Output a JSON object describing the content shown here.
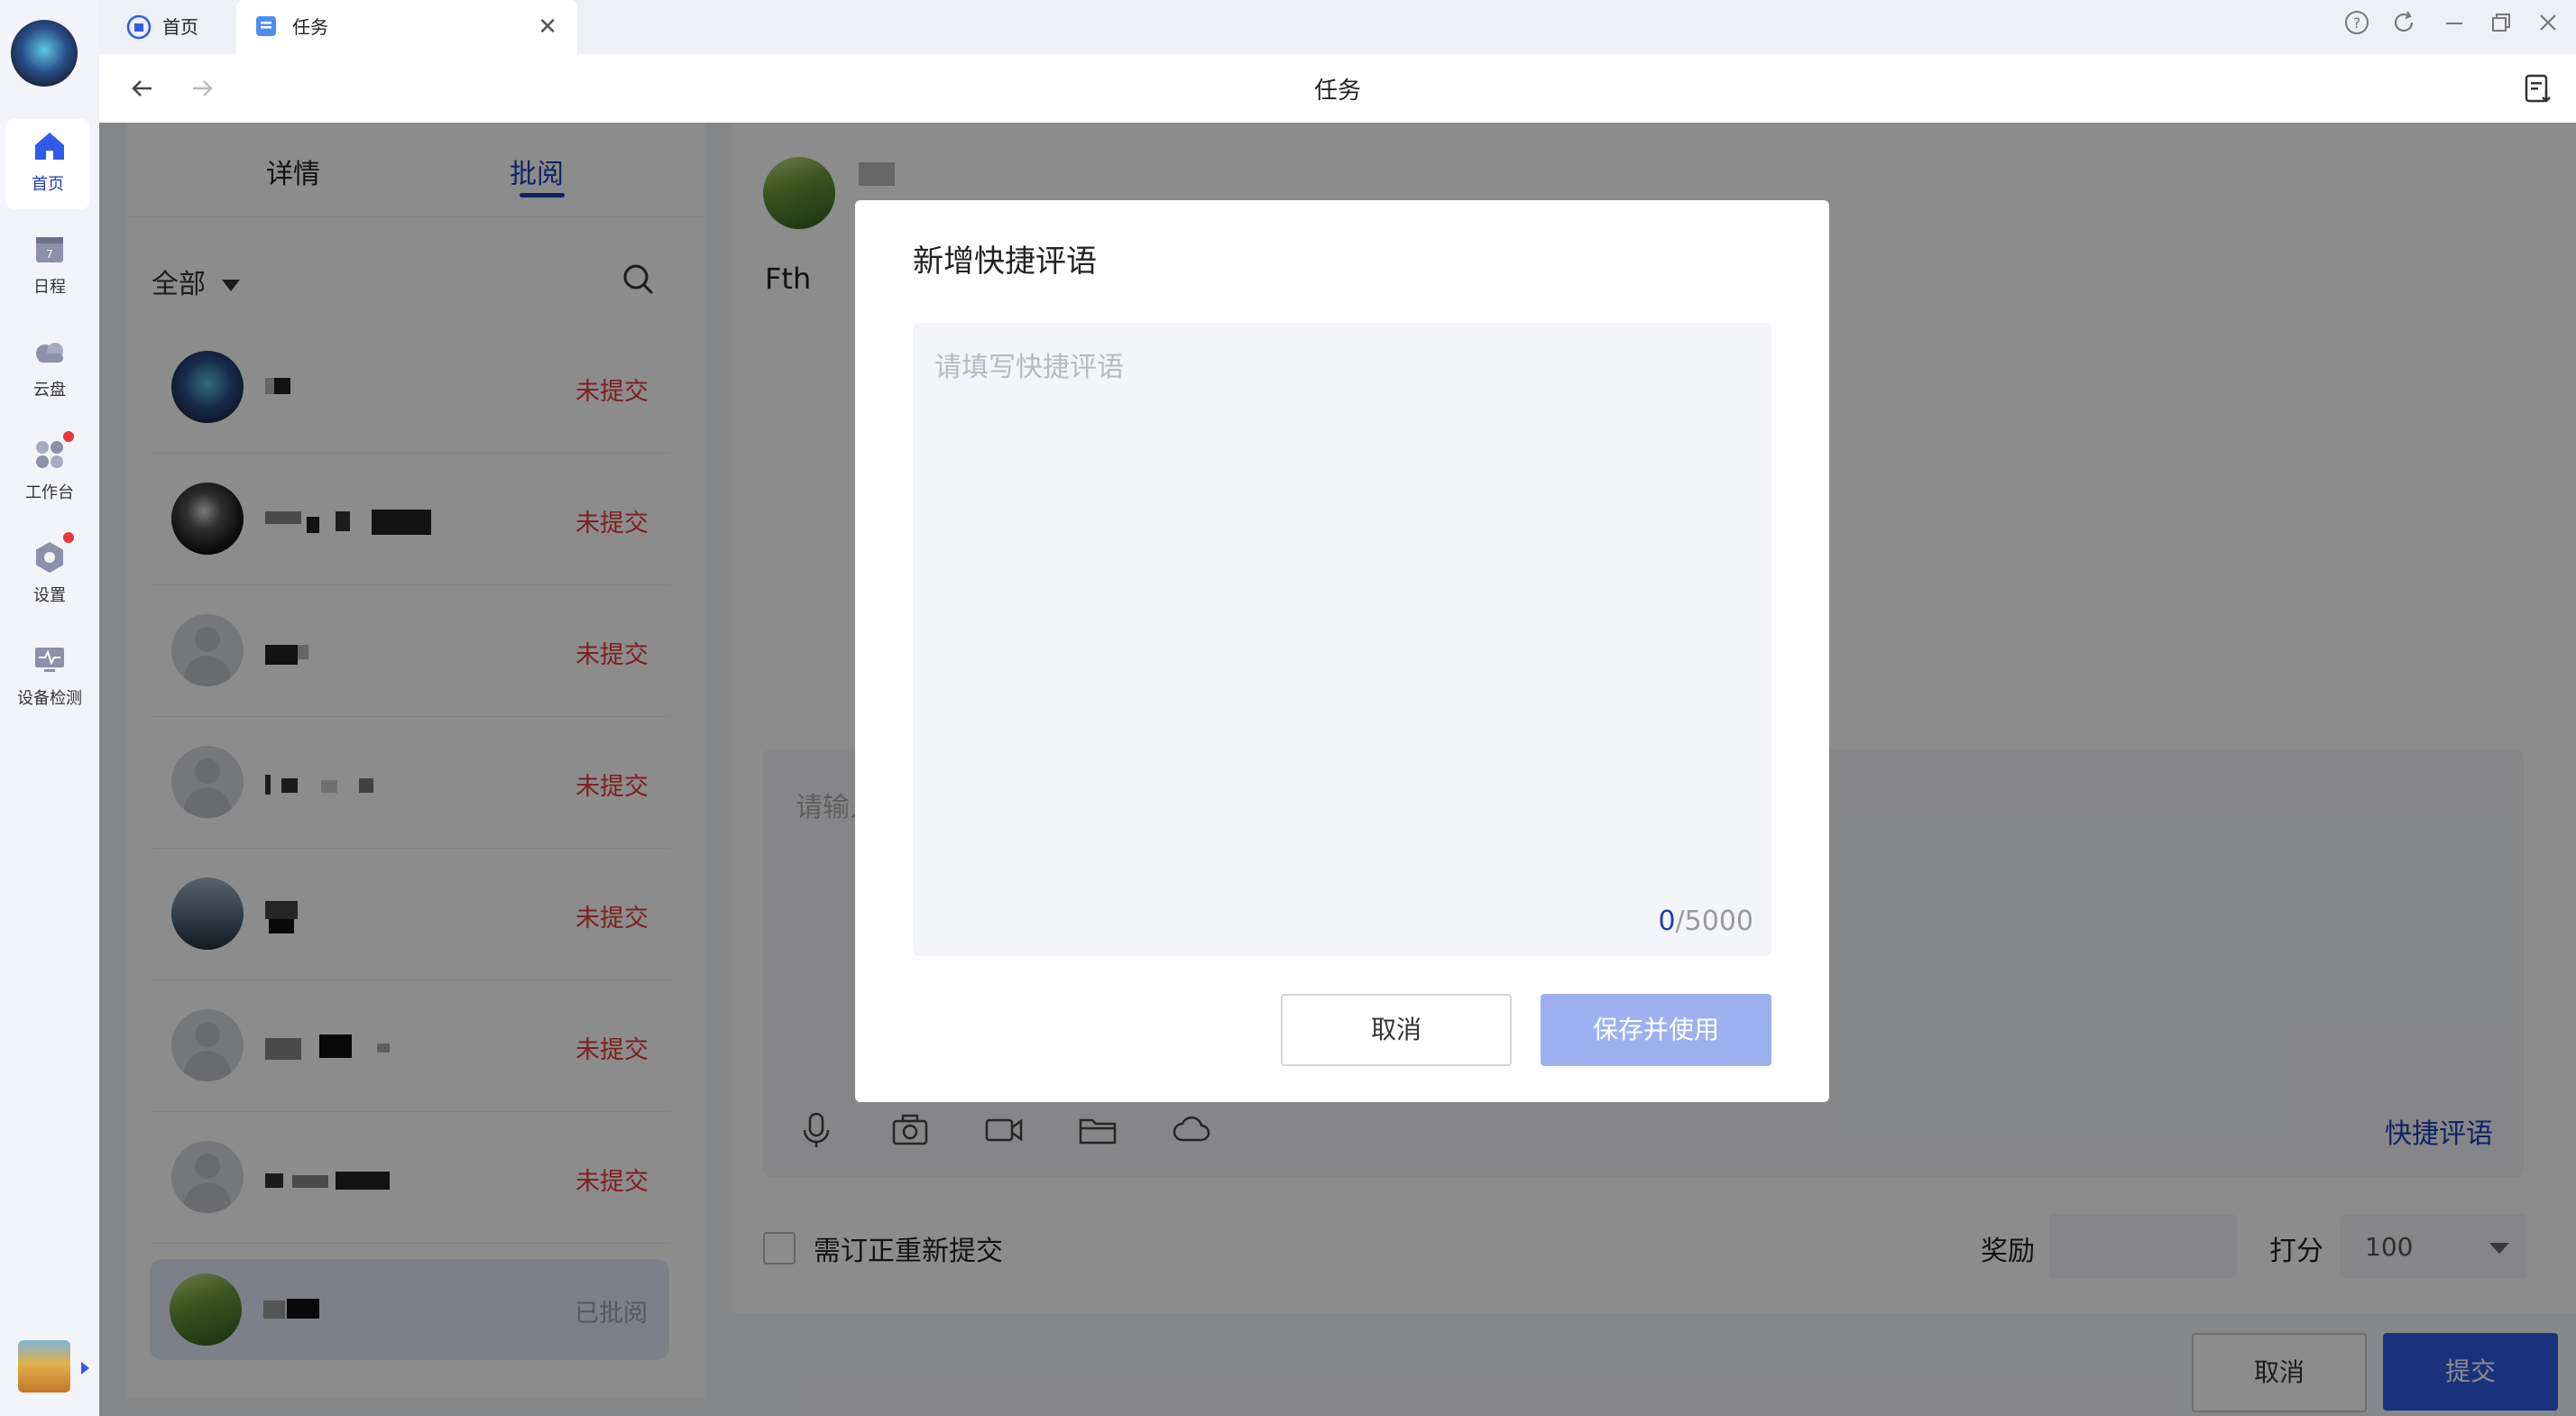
{
  "rail": {
    "items": [
      {
        "label": "首页"
      },
      {
        "label": "日程"
      },
      {
        "label": "云盘"
      },
      {
        "label": "工作台"
      },
      {
        "label": "设置"
      },
      {
        "label": "设备检测"
      }
    ]
  },
  "tabs": [
    {
      "label": "首页"
    },
    {
      "label": "任务"
    }
  ],
  "nav": {
    "title": "任务"
  },
  "left": {
    "tabs": [
      "详情",
      "批阅"
    ],
    "filter": "全部",
    "rows": [
      {
        "status": "未提交"
      },
      {
        "status": "未提交"
      },
      {
        "status": "未提交"
      },
      {
        "status": "未提交"
      },
      {
        "status": "未提交"
      },
      {
        "status": "未提交"
      },
      {
        "status": "未提交"
      },
      {
        "status": "已批阅"
      }
    ]
  },
  "right": {
    "text": "Fth",
    "input_placeholder": "请输入",
    "quick_comment": "快捷评语",
    "revise_label": "需订正重新提交",
    "reward_label": "奖励",
    "score_label": "打分",
    "score_value": "100",
    "cancel": "取消",
    "submit": "提交"
  },
  "modal": {
    "title": "新增快捷评语",
    "placeholder": "请填写快捷评语",
    "count_current": "0",
    "count_max": "/5000",
    "cancel": "取消",
    "save": "保存并使用"
  },
  "colors": {
    "accent": "#1f3fb4",
    "danger": "#e6393e",
    "save_disabled": "#9db1f0"
  }
}
